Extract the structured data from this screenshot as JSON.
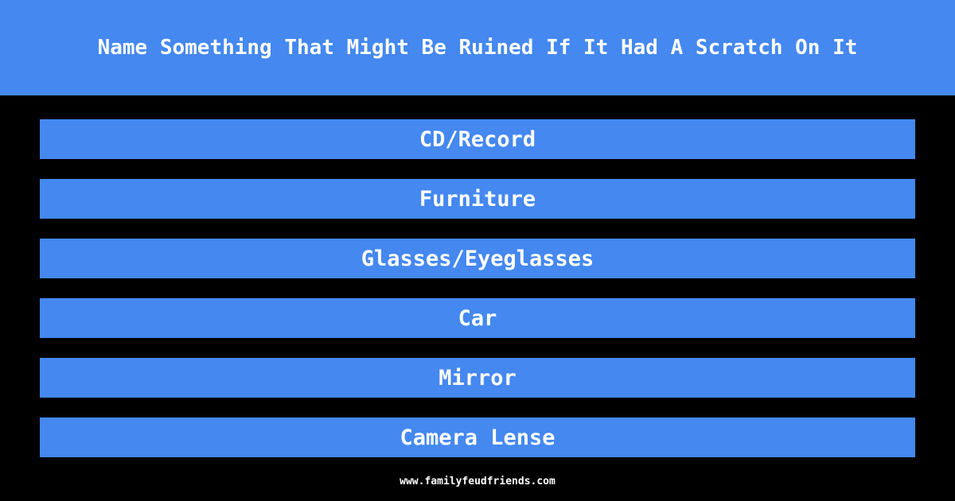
{
  "question": "Name Something That Might Be Ruined If It Had A Scratch On It",
  "answers": [
    "CD/Record",
    "Furniture",
    "Glasses/Eyeglasses",
    "Car",
    "Mirror",
    "Camera Lense"
  ],
  "footer": "www.familyfeudfriends.com",
  "colors": {
    "accent": "#4488f0",
    "background": "#000000",
    "text": "#ffffff"
  }
}
